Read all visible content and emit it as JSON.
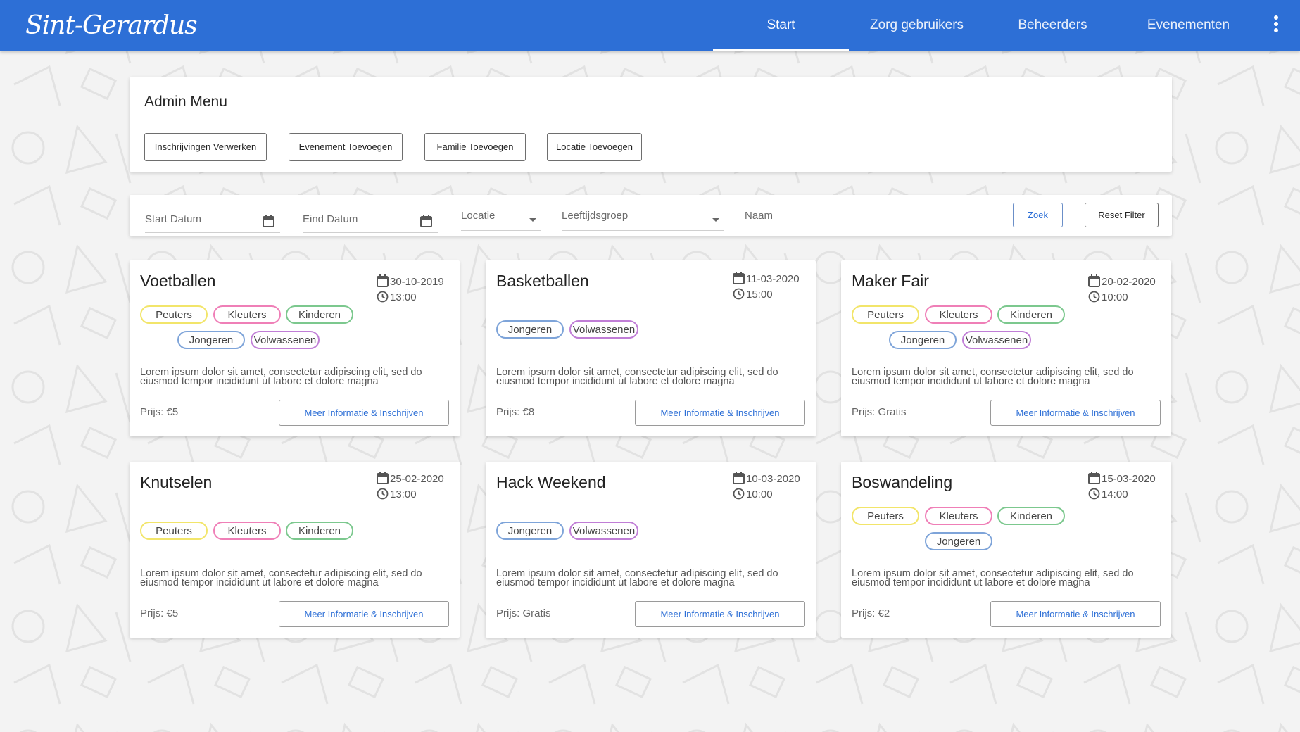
{
  "app": {
    "logo_text": "Sint-Gerardus"
  },
  "nav": {
    "tabs": [
      {
        "label": "Start",
        "active": true
      },
      {
        "label": "Zorg gebruikers",
        "active": false
      },
      {
        "label": "Beheerders",
        "active": false
      },
      {
        "label": "Evenementen",
        "active": false
      }
    ],
    "more_icon": "vertical-dots-icon"
  },
  "admin": {
    "title": "Admin Menu",
    "buttons": [
      "Inschrijvingen Verwerken",
      "Evenement Toevoegen",
      "Familie Toevoegen",
      "Locatie Toevoegen"
    ]
  },
  "filter": {
    "start_date_placeholder": "Start Datum",
    "end_date_placeholder": "Eind Datum",
    "location_label": "Locatie",
    "age_group_label": "Leeftijdsgroep",
    "name_placeholder": "Naam",
    "search_label": "Zoek",
    "reset_label": "Reset Filter"
  },
  "tag_colors": {
    "Peuters": "#f2e56a",
    "Kleuters": "#ef7fb7",
    "Kinderen": "#7cc88e",
    "Jongeren": "#7ea4d9",
    "Volwassenen": "#c07ed6"
  },
  "colors": {
    "brand": "#2d6fd6",
    "background": "#f3f3f3"
  },
  "events": [
    {
      "title": "Voetballen",
      "date": "30-10-2019",
      "time": "13:00",
      "tags": [
        "Peuters",
        "Kleuters",
        "Kinderen",
        "Jongeren",
        "Volwassenen"
      ],
      "description": "Lorem ipsum dolor sit amet, consectetur adipiscing elit, sed do eiusmod tempor incididunt ut labore et dolore magna",
      "price": "Prijs: €5",
      "button": "Meer Informatie & Inschrijven"
    },
    {
      "title": "Basketballen",
      "date": "11-03-2020",
      "time": "15:00",
      "tags": [
        "Jongeren",
        "Volwassenen"
      ],
      "description": "Lorem ipsum dolor sit amet, consectetur adipiscing elit, sed do eiusmod tempor incididunt ut labore et dolore magna",
      "price": "Prijs: €8",
      "button": "Meer Informatie & Inschrijven"
    },
    {
      "title": "Maker Fair",
      "date": "20-02-2020",
      "time": "10:00",
      "tags": [
        "Peuters",
        "Kleuters",
        "Kinderen",
        "Jongeren",
        "Volwassenen"
      ],
      "description": "Lorem ipsum dolor sit amet, consectetur adipiscing elit, sed do eiusmod tempor incididunt ut labore et dolore magna",
      "price": "Prijs: Gratis",
      "button": "Meer Informatie & Inschrijven"
    },
    {
      "title": "Knutselen",
      "date": "25-02-2020",
      "time": "13:00",
      "tags": [
        "Peuters",
        "Kleuters",
        "Kinderen"
      ],
      "description": "Lorem ipsum dolor sit amet, consectetur adipiscing elit, sed do eiusmod tempor incididunt ut labore et dolore magna",
      "price": "Prijs: €5",
      "button": "Meer Informatie & Inschrijven"
    },
    {
      "title": "Hack Weekend",
      "date": "10-03-2020",
      "time": "10:00",
      "tags": [
        "Jongeren",
        "Volwassenen"
      ],
      "description": "Lorem ipsum dolor sit amet, consectetur adipiscing elit, sed do eiusmod tempor incididunt ut labore et dolore magna",
      "price": "Prijs: Gratis",
      "button": "Meer Informatie & Inschrijven"
    },
    {
      "title": "Boswandeling",
      "date": "15-03-2020",
      "time": "14:00",
      "tags": [
        "Peuters",
        "Kleuters",
        "Kinderen",
        "Jongeren"
      ],
      "description": "Lorem ipsum dolor sit amet, consectetur adipiscing elit, sed do eiusmod tempor incididunt ut labore et dolore magna",
      "price": "Prijs: €2",
      "button": "Meer Informatie & Inschrijven"
    }
  ]
}
